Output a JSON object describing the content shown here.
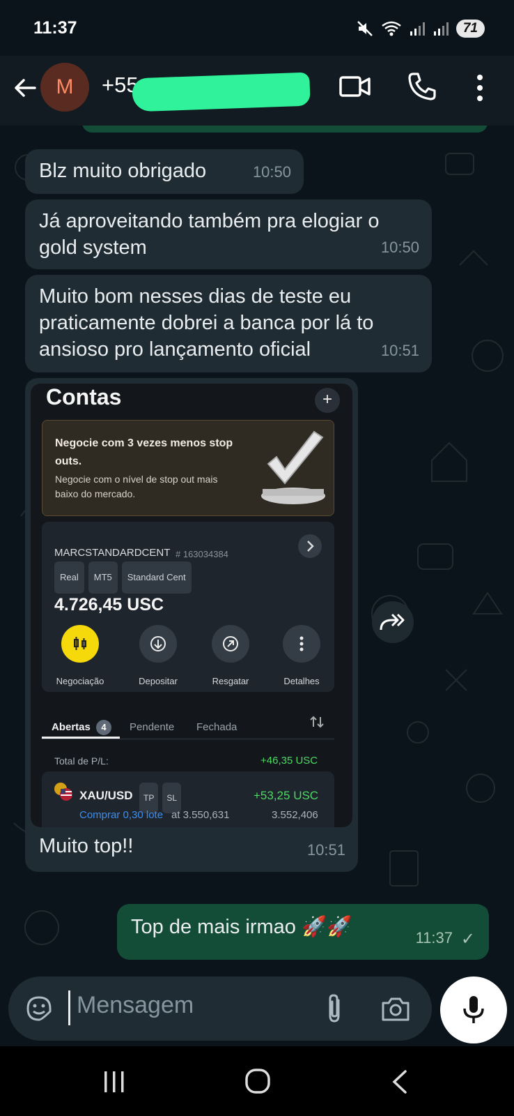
{
  "status_bar": {
    "time": "11:37",
    "battery": "71"
  },
  "header": {
    "avatar_letter": "M",
    "contact_name": "+55"
  },
  "messages": [
    {
      "text": "Blz muito obrigado",
      "time": "10:50",
      "direction": "in"
    },
    {
      "text": "Já aproveitando também pra elogiar o gold system",
      "time": "10:50",
      "direction": "in"
    },
    {
      "text": "Muito bom nesses dias de teste eu praticamente dobrei a banca por lá to ansioso pro lançamento oficial",
      "time": "10:51",
      "direction": "in"
    },
    {
      "text": "Muito top!!",
      "time": "10:51",
      "direction": "in",
      "has_image": true
    },
    {
      "text": "Top de mais irmao 🚀🚀",
      "time": "11:37",
      "direction": "out",
      "status": "✓"
    }
  ],
  "screenshot": {
    "title": "Contas",
    "add_symbol": "+",
    "promo": {
      "title": "Negocie com 3 vezes menos stop outs.",
      "subtitle": "Negocie com o nível de stop out mais baixo do mercado."
    },
    "account": {
      "name": "MARCSTANDARDCENT",
      "number": "# 163034384",
      "tags": [
        "Real",
        "MT5",
        "Standard Cent"
      ],
      "balance": "4.726,45 USC",
      "actions": [
        {
          "label": "Negociação",
          "icon": "trade-icon"
        },
        {
          "label": "Depositar",
          "icon": "deposit-icon"
        },
        {
          "label": "Resgatar",
          "icon": "withdraw-icon"
        },
        {
          "label": "Detalhes",
          "icon": "more-icon"
        }
      ]
    },
    "tabs": [
      {
        "label": "Abertas",
        "badge": "4",
        "active": true
      },
      {
        "label": "Pendente",
        "active": false
      },
      {
        "label": "Fechada",
        "active": false
      }
    ],
    "pl_label": "Total de P/L:",
    "pl_value": "+46,35 USC",
    "trade": {
      "symbol": "XAU/USD",
      "tags": [
        "TP",
        "SL"
      ],
      "pl": "+53,25 USC",
      "action": "Comprar 0,30 lote",
      "at_label": "at 3.550,631",
      "current": "3.552,406"
    }
  },
  "input": {
    "placeholder": "Mensagem"
  },
  "colors": {
    "background": "#0b141a",
    "incoming_bubble": "#202c33",
    "outgoing_bubble": "#144d37",
    "accent_green": "#2ff29b",
    "trade_yellow": "#f5d90a",
    "profit_green": "#4cd964"
  }
}
